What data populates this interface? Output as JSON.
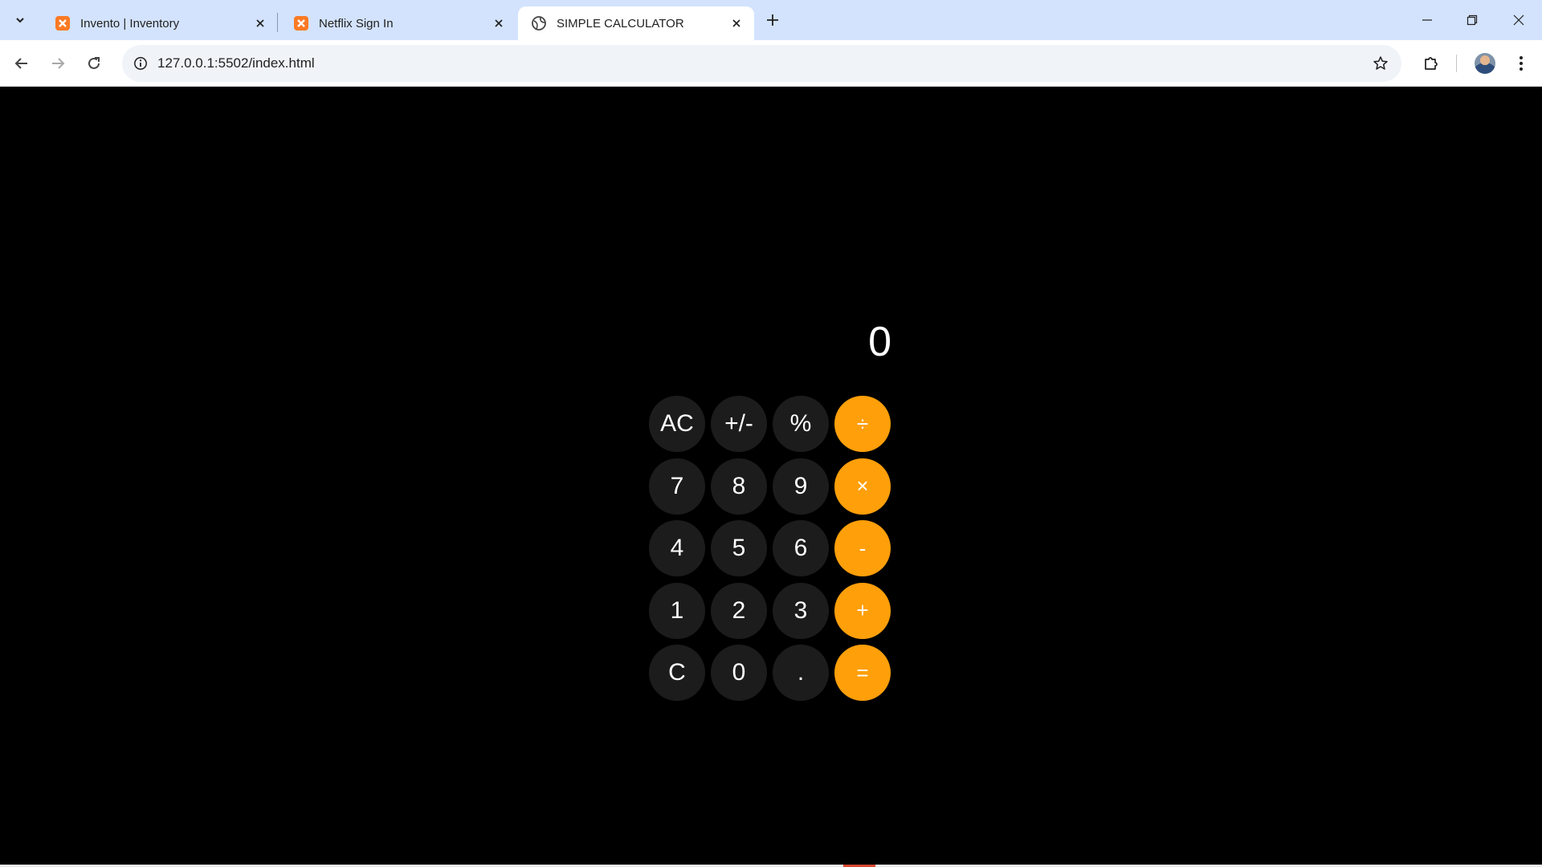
{
  "browser": {
    "tabs": [
      {
        "title": "Invento | Inventory",
        "favicon": "xampp-icon",
        "active": false
      },
      {
        "title": "Netflix Sign In",
        "favicon": "xampp-icon",
        "active": false
      },
      {
        "title": "SIMPLE CALCULATOR",
        "favicon": "globe-icon",
        "active": true
      }
    ],
    "address": "127.0.0.1:5502/index.html"
  },
  "calculator": {
    "display": "0",
    "keys": [
      [
        "AC",
        "+/-",
        "%",
        "÷"
      ],
      [
        "7",
        "8",
        "9",
        "×"
      ],
      [
        "4",
        "5",
        "6",
        "-"
      ],
      [
        "1",
        "2",
        "3",
        "+"
      ],
      [
        "C",
        "0",
        ".",
        "="
      ]
    ]
  },
  "colors": {
    "page_background": "#000000",
    "key_background": "#1c1c1c",
    "operator_background": "#ff9f0a",
    "text": "#ffffff"
  }
}
